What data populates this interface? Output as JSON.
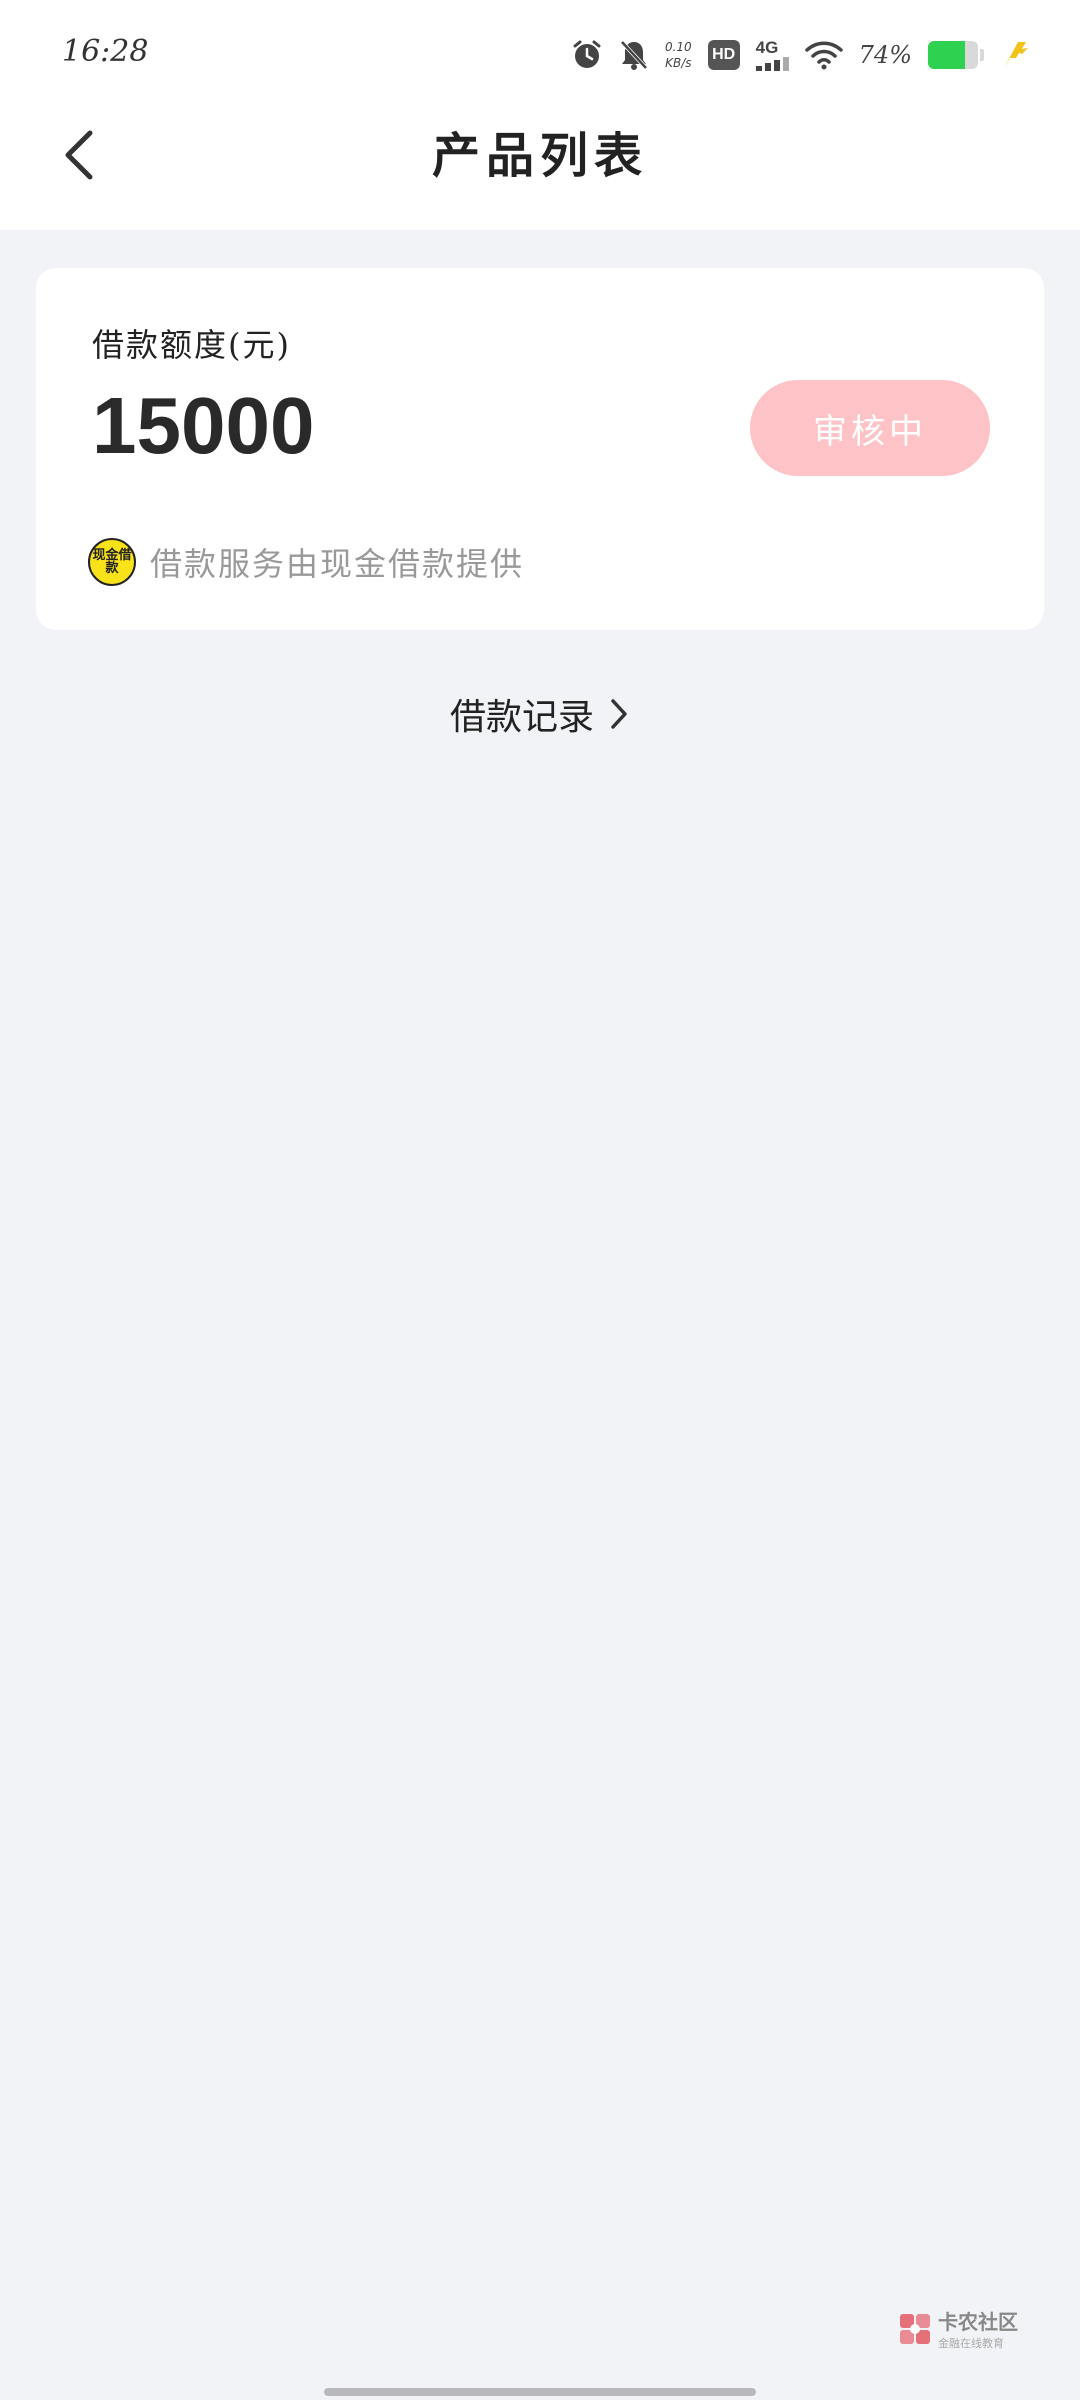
{
  "status_bar": {
    "time": "16:28",
    "net_speed_value": "0.10",
    "net_speed_unit": "KB/s",
    "hd_label": "HD",
    "network_type": "4G",
    "battery_percent": "74%",
    "battery_level": 0.74,
    "icons": [
      "alarm-icon",
      "mute-bell-icon",
      "wifi-icon",
      "charging-icon"
    ]
  },
  "nav": {
    "title": "产品列表",
    "back_icon": "chevron-left-icon"
  },
  "loan_card": {
    "limit_label": "借款额度(元)",
    "limit_amount": "15000",
    "status_button_label": "审核中",
    "status_button_color": "#fec3c6",
    "provider_logo_text": "现金借款",
    "provider_text": "借款服务由现金借款提供"
  },
  "records_link": {
    "label": "借款记录"
  },
  "watermark": {
    "title": "卡农社区",
    "subtitle": "金融在线教育"
  },
  "colors": {
    "background": "#f2f3f7",
    "card": "#ffffff",
    "battery_fill": "#2fd150",
    "charging": "#f0c419"
  }
}
